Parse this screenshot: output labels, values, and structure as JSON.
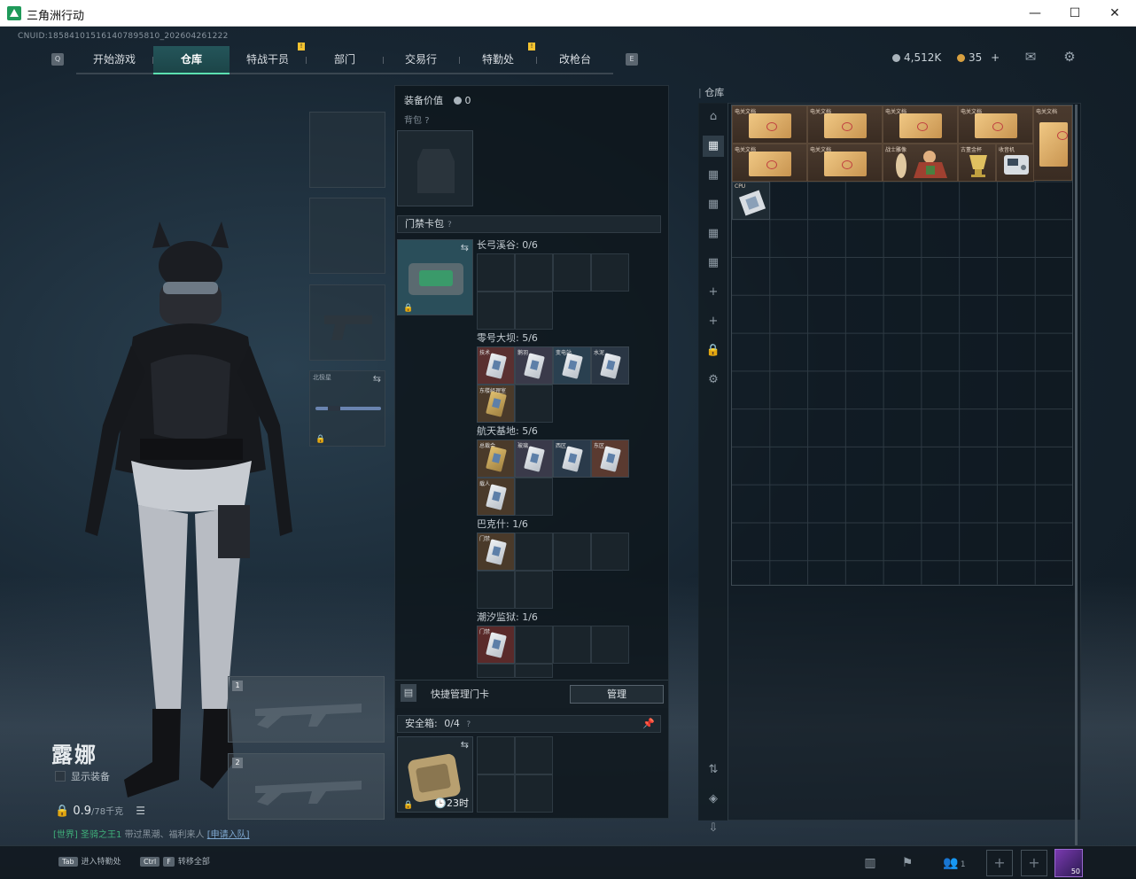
{
  "window": {
    "title": "三角洲行动",
    "minimize": "—",
    "maximize": "☐",
    "close": "✕"
  },
  "uid": "CNUID:1858410151614078958­10_202604261222",
  "nav": {
    "key_left": "Q",
    "key_right": "E",
    "tabs": [
      "开始游戏",
      "仓库",
      "特战干员",
      "部门",
      "交易行",
      "特勤处",
      "改枪台"
    ],
    "active_index": 1,
    "badges": [
      "!",
      "!"
    ]
  },
  "currency": {
    "coins": "4,512K",
    "bonds": "35",
    "bonds_plus": "+"
  },
  "character": {
    "name": "露娜",
    "show_equip_label": "显示装备",
    "weight": "0.9",
    "weight_max": "/78千克"
  },
  "world_chat": {
    "tag": "[世界]",
    "user": "圣骑之王1",
    "text": "带过黑潮、福利来人",
    "link": "[申请入队]"
  },
  "equipment": {
    "melee_label": "北极星",
    "weapon_slot_1": "1",
    "weapon_slot_2": "2"
  },
  "middle": {
    "value_label": "装备价值",
    "value": "0",
    "backpack_label": "背包",
    "keycard_label": "门禁卡包",
    "q": "?",
    "maps": [
      {
        "name": "长弓溪谷: 0/6"
      },
      {
        "name": "零号大坝: 5/6"
      },
      {
        "name": "航天基地: 5/6"
      },
      {
        "name": "巴克什: 1/6"
      },
      {
        "name": "潮汐监狱: 1/6"
      }
    ],
    "dam_cards": [
      "技术",
      "鹅羽",
      "变电站",
      "水泥",
      "东楼经理室"
    ],
    "space_cards": [
      "总裁会",
      "玻璃",
      "西区",
      "东区",
      "载人"
    ],
    "baksh_cards": [
      "门禁"
    ],
    "tide_cards": [
      "门禁"
    ],
    "quick_manage_label": "快捷管理门卡",
    "manage_button": "管理",
    "safebox_label": "安全箱:",
    "safebox_count": "0/4",
    "safebox_time": "23时",
    "pin_icon": "pin-icon"
  },
  "warehouse": {
    "title": "仓库",
    "items_row1": [
      "电关文档",
      "电关文档",
      "电关文档",
      "电关文档",
      "电关文档"
    ],
    "items_row2": [
      "电关文档",
      "电关文档",
      "战士雕像",
      "古董金杯",
      "收音机"
    ],
    "cpu_label": "CPU"
  },
  "bottom": {
    "hint1_key": "Tab",
    "hint1_text": "进入特勤处",
    "hint2_key1": "Ctrl",
    "hint2_key2": "F",
    "hint2_text": "转移全部",
    "squad_count": "1",
    "avatar_level": "50"
  }
}
